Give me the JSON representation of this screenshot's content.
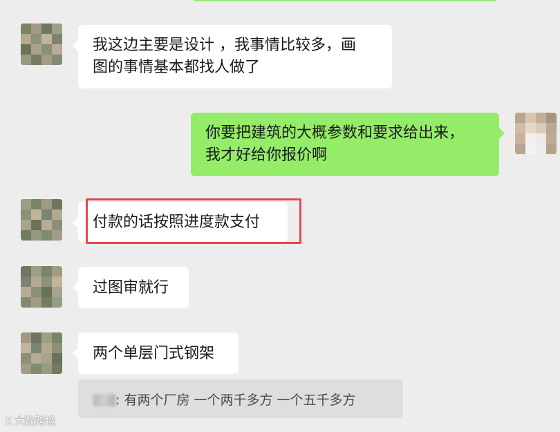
{
  "messages": [
    {
      "side": "left",
      "lines": [
        "我这边主要是设计 ，我事情比较多，画",
        "图的事情基本都找人做了"
      ]
    },
    {
      "side": "right",
      "lines": [
        "你要把建筑的大概参数和要求给出来，",
        "我才好给你报价啊"
      ]
    },
    {
      "side": "left",
      "lines": [
        "付款的话按照进度款支付"
      ],
      "highlighted": true
    },
    {
      "side": "left",
      "lines": [
        "过图审就行"
      ]
    },
    {
      "side": "left",
      "lines": [
        "两个单层门式钢架"
      ]
    }
  ],
  "quote": {
    "sender_suffix": ":",
    "text": "有两个厂房  一个两千多方   一个五千多方"
  },
  "watermark": {
    "icon": "K",
    "text": "大数跨境"
  },
  "colors": {
    "background": "#ededed",
    "incoming_bubble": "#ffffff",
    "outgoing_bubble": "#95ec69",
    "highlight_border": "#e8474d",
    "quote_background": "#dedede"
  }
}
